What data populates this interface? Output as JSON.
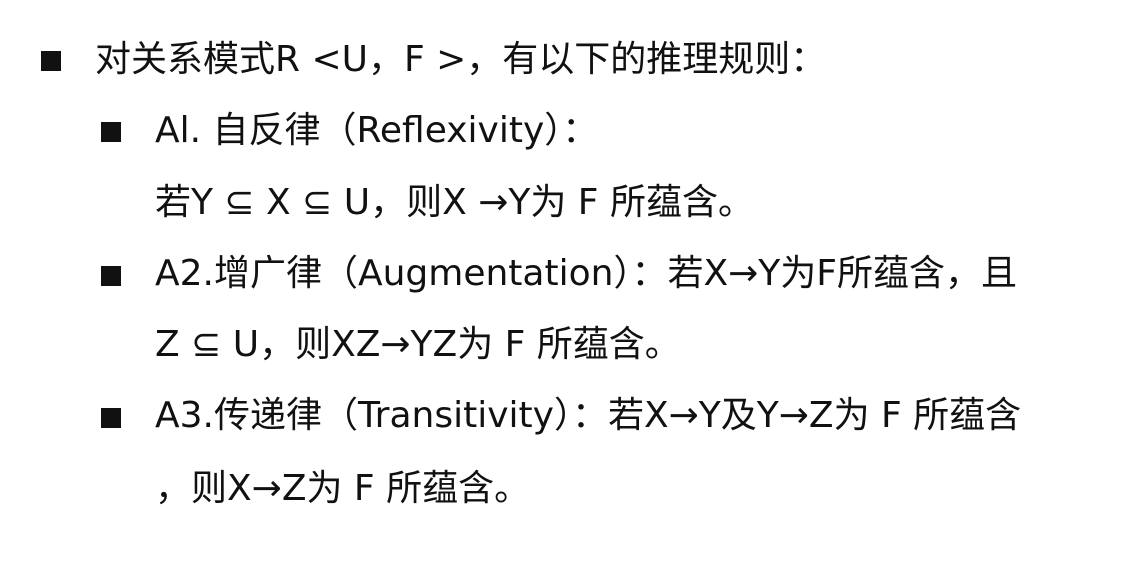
{
  "main": {
    "heading": "对关系模式R <U，F >，有以下的推理规则：",
    "rules": [
      {
        "line1": "Al. 自反律（Reflexivity）：",
        "line2": "若Y ⊆ X ⊆ U，则X →Y为 F 所蕴含。"
      },
      {
        "line1": "A2.增广律（Augmentation）：若X→Y为F所蕴含，且",
        "line2": "Z ⊆ U，则XZ→YZ为 F 所蕴含。"
      },
      {
        "line1": "A3.传递律（Transitivity）：若X→Y及Y→Z为 F 所蕴含",
        "line2": "，则X→Z为 F 所蕴含。"
      }
    ]
  }
}
